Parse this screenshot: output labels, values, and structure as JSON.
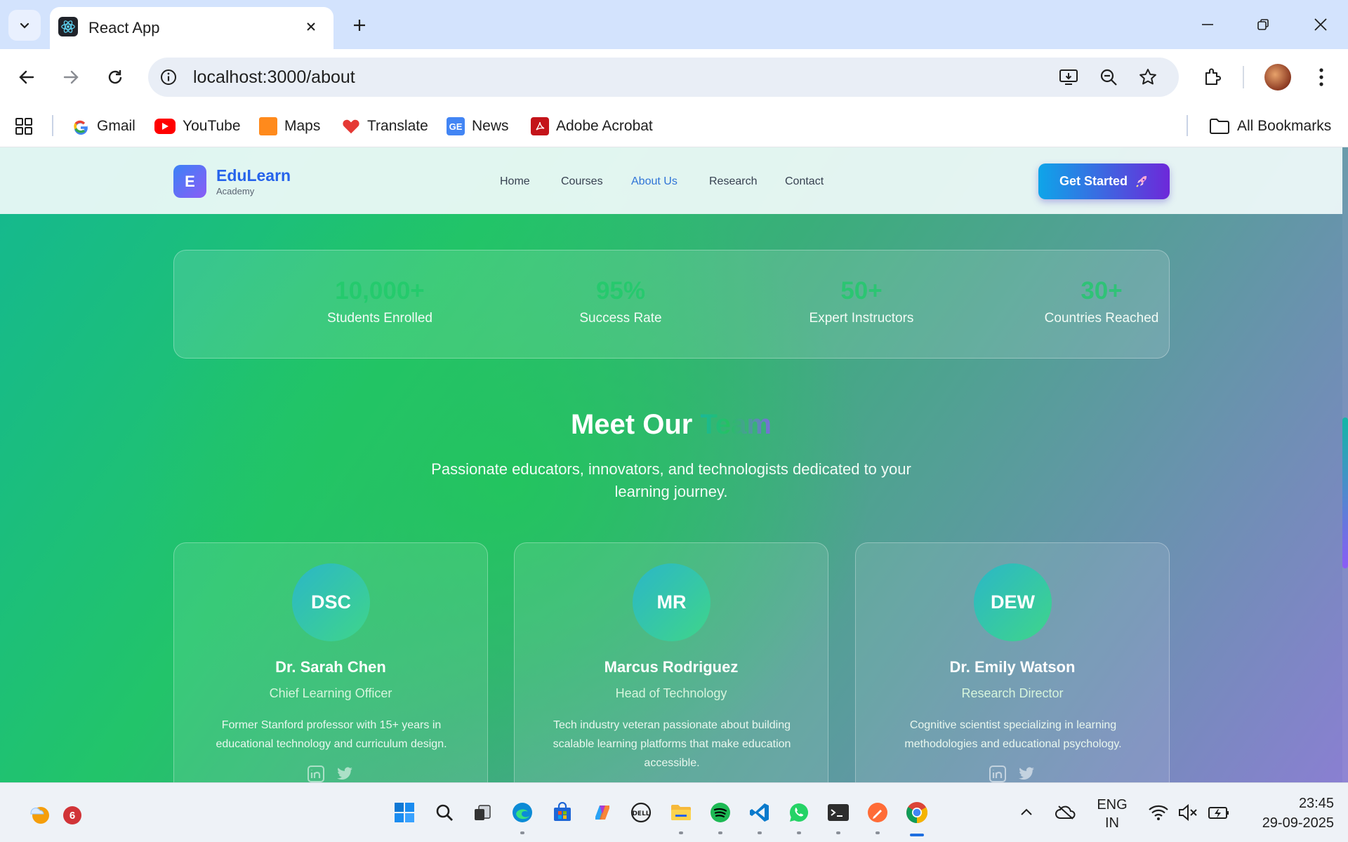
{
  "browser": {
    "tab_title": "React App",
    "url": "localhost:3000/about",
    "bookmarks": [
      {
        "label": "Gmail",
        "icon": "gmail-icon"
      },
      {
        "label": "YouTube",
        "icon": "youtube-icon"
      },
      {
        "label": "Maps",
        "icon": "maps-icon"
      },
      {
        "label": "Translate",
        "icon": "translate-icon"
      },
      {
        "label": "News",
        "icon": "news-icon"
      },
      {
        "label": "Adobe Acrobat",
        "icon": "adobe-acrobat-icon"
      }
    ],
    "all_bookmarks": "All Bookmarks"
  },
  "site": {
    "logo_letter": "E",
    "brand": "EduLearn",
    "brand_sub": "Academy",
    "nav": [
      "Home",
      "Courses",
      "About Us",
      "Research",
      "Contact"
    ],
    "active_nav": "About Us",
    "cta": "Get Started",
    "cta_icon": "rocket-icon"
  },
  "stats": [
    {
      "value": "10,000+",
      "label": "Students Enrolled"
    },
    {
      "value": "95%",
      "label": "Success Rate"
    },
    {
      "value": "50+",
      "label": "Expert Instructors"
    },
    {
      "value": "30+",
      "label": "Countries Reached"
    }
  ],
  "team": {
    "title_main": "Meet Our",
    "title_accent": "Team",
    "subtitle": "Passionate educators, innovators, and technologists dedicated to your learning journey.",
    "members": [
      {
        "initials": "DSC",
        "name": "Dr. Sarah Chen",
        "role": "Chief Learning Officer",
        "bio": "Former Stanford professor with 15+ years in educational technology and curriculum design."
      },
      {
        "initials": "MR",
        "name": "Marcus Rodriguez",
        "role": "Head of Technology",
        "bio": "Tech industry veteran passionate about building scalable learning platforms that make education accessible."
      },
      {
        "initials": "DEW",
        "name": "Dr. Emily Watson",
        "role": "Research Director",
        "bio": "Cognitive scientist specializing in learning methodologies and educational psychology."
      }
    ]
  },
  "taskbar": {
    "weather_badge": "6",
    "language": "ENG",
    "region": "IN",
    "time": "23:45",
    "date": "29-09-2025"
  },
  "colors": {
    "accent_blue": "#2563eb",
    "cta_start": "#0ea5e9",
    "cta_end": "#6d28d9",
    "stat_green": "#1ccb68"
  }
}
